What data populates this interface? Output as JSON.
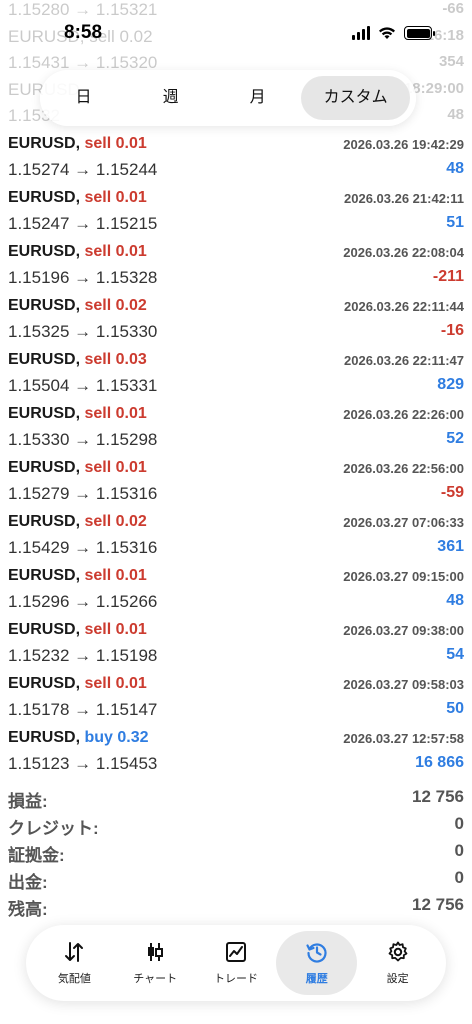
{
  "status_bar": {
    "time": "8:58"
  },
  "faded_rows": [
    {
      "left": "1.15280 → 1.15321",
      "right": "-66"
    },
    {
      "left": "EURUSD, sell 0.02",
      "right": "16:18"
    },
    {
      "left": "1.15431 → 1.15320",
      "right": "354"
    },
    {
      "left": "EURUSD",
      "right": "18:29:00"
    },
    {
      "left": "1.1532",
      "right": "48"
    }
  ],
  "period_tabs": [
    "日",
    "週",
    "月",
    "カスタム"
  ],
  "trades": [
    {
      "symbol": "EURUSD,",
      "side": "sell",
      "label": "sell 0.01",
      "time": "2026.03.26 19:42:29",
      "prices": "1.15274 → 1.15244",
      "profit": "48",
      "sign": "pos"
    },
    {
      "symbol": "EURUSD,",
      "side": "sell",
      "label": "sell 0.01",
      "time": "2026.03.26 21:42:11",
      "prices": "1.15247 → 1.15215",
      "profit": "51",
      "sign": "pos"
    },
    {
      "symbol": "EURUSD,",
      "side": "sell",
      "label": "sell 0.01",
      "time": "2026.03.26 22:08:04",
      "prices": "1.15196 → 1.15328",
      "profit": "-211",
      "sign": "neg"
    },
    {
      "symbol": "EURUSD,",
      "side": "sell",
      "label": "sell 0.02",
      "time": "2026.03.26 22:11:44",
      "prices": "1.15325 → 1.15330",
      "profit": "-16",
      "sign": "neg"
    },
    {
      "symbol": "EURUSD,",
      "side": "sell",
      "label": "sell 0.03",
      "time": "2026.03.26 22:11:47",
      "prices": "1.15504 → 1.15331",
      "profit": "829",
      "sign": "pos"
    },
    {
      "symbol": "EURUSD,",
      "side": "sell",
      "label": "sell 0.01",
      "time": "2026.03.26 22:26:00",
      "prices": "1.15330 → 1.15298",
      "profit": "52",
      "sign": "pos"
    },
    {
      "symbol": "EURUSD,",
      "side": "sell",
      "label": "sell 0.01",
      "time": "2026.03.26 22:56:00",
      "prices": "1.15279 → 1.15316",
      "profit": "-59",
      "sign": "neg"
    },
    {
      "symbol": "EURUSD,",
      "side": "sell",
      "label": "sell 0.02",
      "time": "2026.03.27 07:06:33",
      "prices": "1.15429 → 1.15316",
      "profit": "361",
      "sign": "pos"
    },
    {
      "symbol": "EURUSD,",
      "side": "sell",
      "label": "sell 0.01",
      "time": "2026.03.27 09:15:00",
      "prices": "1.15296 → 1.15266",
      "profit": "48",
      "sign": "pos"
    },
    {
      "symbol": "EURUSD,",
      "side": "sell",
      "label": "sell 0.01",
      "time": "2026.03.27 09:38:00",
      "prices": "1.15232 → 1.15198",
      "profit": "54",
      "sign": "pos"
    },
    {
      "symbol": "EURUSD,",
      "side": "sell",
      "label": "sell 0.01",
      "time": "2026.03.27 09:58:03",
      "prices": "1.15178 → 1.15147",
      "profit": "50",
      "sign": "pos"
    },
    {
      "symbol": "EURUSD,",
      "side": "buy",
      "label": "buy 0.32",
      "time": "2026.03.27 12:57:58",
      "prices": "1.15123 → 1.15453",
      "profit": "16 866",
      "sign": "pos"
    }
  ],
  "summary": [
    {
      "label": "損益:",
      "value": "12 756"
    },
    {
      "label": "クレジット:",
      "value": "0"
    },
    {
      "label": "証拠金:",
      "value": "0"
    },
    {
      "label": "出金:",
      "value": "0"
    },
    {
      "label": "残高:",
      "value": "12 756"
    }
  ],
  "tabbar": [
    {
      "label": "気配値",
      "icon": "quotes-arrows-icon",
      "active": false
    },
    {
      "label": "チャート",
      "icon": "candlestick-icon",
      "active": false
    },
    {
      "label": "トレード",
      "icon": "trade-chart-icon",
      "active": false
    },
    {
      "label": "履歴",
      "icon": "history-clock-icon",
      "active": true
    },
    {
      "label": "設定",
      "icon": "gear-icon",
      "active": false
    }
  ],
  "colors": {
    "sell": "#cc3b2f",
    "buy": "#2f7de1",
    "profit_pos": "#2f7de1",
    "profit_neg": "#cc3b2f"
  }
}
